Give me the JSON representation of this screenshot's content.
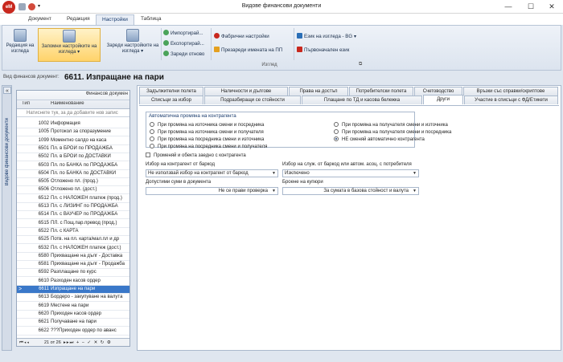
{
  "window": {
    "title": "Видове финансови документи",
    "minimize": "—",
    "maximize": "☐",
    "close": "✕"
  },
  "app_logo": "eM",
  "ribbon_tabs": [
    "Документ",
    "Редакция",
    "Настройки",
    "Таблица"
  ],
  "ribbon": {
    "btn_edit_views": "Редакция на изгледа",
    "btn_save_settings": "Запомни настройките на изгледа ▾",
    "btn_load_settings": "Зареди настройките на изгледа ▾",
    "import": "Импортирай...",
    "export": "Експортирай...",
    "reload": "Зареди отново",
    "factory": "Фабрични настройки",
    "rename_pp": "Презареди имената на ПП",
    "language": "Език на изгледа - BG ▾",
    "initial_lang": "Първоначален език",
    "group_label": "Изглед"
  },
  "doc_header": {
    "label": "Вид финансов документ:",
    "title": "6611. Изпращане на пари"
  },
  "left_strip": {
    "collapse": "«",
    "vertical_label": "Видове финансови документи"
  },
  "list": {
    "group_header": "Финансов докумен",
    "col_type": "Тип",
    "col_name": "Наименование",
    "new_row_hint": "Натиснете тук, за да добавите нов запис",
    "rows": [
      {
        "num": "1002",
        "name": "Информация"
      },
      {
        "num": "1005",
        "name": "Протокол за споразумение"
      },
      {
        "num": "1099",
        "name": "Моментно салдо на каса"
      },
      {
        "num": "6501",
        "name": "Пл. в БРОЙ по ПРОДАЖБА"
      },
      {
        "num": "6502",
        "name": "Пл. в БРОЙ по ДОСТАВКИ"
      },
      {
        "num": "6503",
        "name": "Пл. по БАНКА по ПРОДАЖБА"
      },
      {
        "num": "6504",
        "name": "Пл. по БАНКА по ДОСТАВКИ"
      },
      {
        "num": "6505",
        "name": "Отложено пл. (прод.)"
      },
      {
        "num": "6506",
        "name": "Отложено пл. (дост.)"
      },
      {
        "num": "6512",
        "name": "Пл. с НАЛОЖЕН платеж (прод.)"
      },
      {
        "num": "6513",
        "name": "Пл. с ЛИЗИНГ по ПРОДАЖБА"
      },
      {
        "num": "6514",
        "name": "Пл. с ВАУЧЕР по ПРОДАЖБА"
      },
      {
        "num": "6515",
        "name": "ПЛ. с Пощ.пар.превод (прод.)"
      },
      {
        "num": "6522",
        "name": "Пл. с КАРТА"
      },
      {
        "num": "6525",
        "name": "Потв. на пл. карта/мал.пл и др"
      },
      {
        "num": "6532",
        "name": "Пл. с НАЛОЖЕН платеж (дост.)"
      },
      {
        "num": "6580",
        "name": "Прихващане на дълг - Доставка"
      },
      {
        "num": "6581",
        "name": "Прихващане на дълг - Продажба"
      },
      {
        "num": "6592",
        "name": "Разплащане по курс"
      },
      {
        "num": "6610",
        "name": "Разходен касов ордер"
      },
      {
        "num": "6611",
        "name": "Изпращане на пари"
      },
      {
        "num": "6613",
        "name": "Бордеро - закупуване на валута"
      },
      {
        "num": "6619",
        "name": "Местене на пари"
      },
      {
        "num": "6620",
        "name": "Приходен касов ордер"
      },
      {
        "num": "6621",
        "name": "Получаване на пари"
      },
      {
        "num": "6622",
        "name": "???Приходен ордер по аванс"
      }
    ],
    "selected_index": 20,
    "selected_marker": ">",
    "pager": "21 от 26"
  },
  "tabs_row1": [
    "Задължителни полета",
    "Наличности и дългове",
    "Права на достъп",
    "Потребителски полета",
    "Счетоводство",
    "Връзки със справки/скриптове"
  ],
  "tabs_row2": [
    "Списъци за избор",
    "Подразбиращи се стойности",
    "Плащане по ТД и касова бележка",
    "Други",
    "Участие в списъци с ФД/Етикети"
  ],
  "active_tab_row2": 3,
  "auto_change": {
    "title": "Автоматична промяна на контрагента",
    "options_left": [
      "При промяна на източника смени и посредника",
      "При промяна на източника смени и получателя",
      "При промяна на посредника смени и източника",
      "При промяна на посредника смени и получателя"
    ],
    "options_right": [
      "При промяна на получателя смени и източника",
      "При промяна на получателя смени и посредника",
      "НЕ сменяй автоматично контрагента"
    ],
    "selected": "НЕ сменяй автоматично контрагента"
  },
  "checkbox_label": "Променяй и обекта заедно с контрагента",
  "fields": {
    "barcode_label": "Избор на контрагент от баркод",
    "barcode_value": "Не използвай избор на контрагент от баркод",
    "service_label": "Избор на служ. от баркод или автом. асоц. с потребителя",
    "service_value": "Изключено",
    "sums_label": "Допустими суми в документа",
    "sums_value": "Не се прави проверка",
    "coupons_label": "Броене на купюри",
    "coupons_value": "За сумата в базова стойност и валута"
  }
}
